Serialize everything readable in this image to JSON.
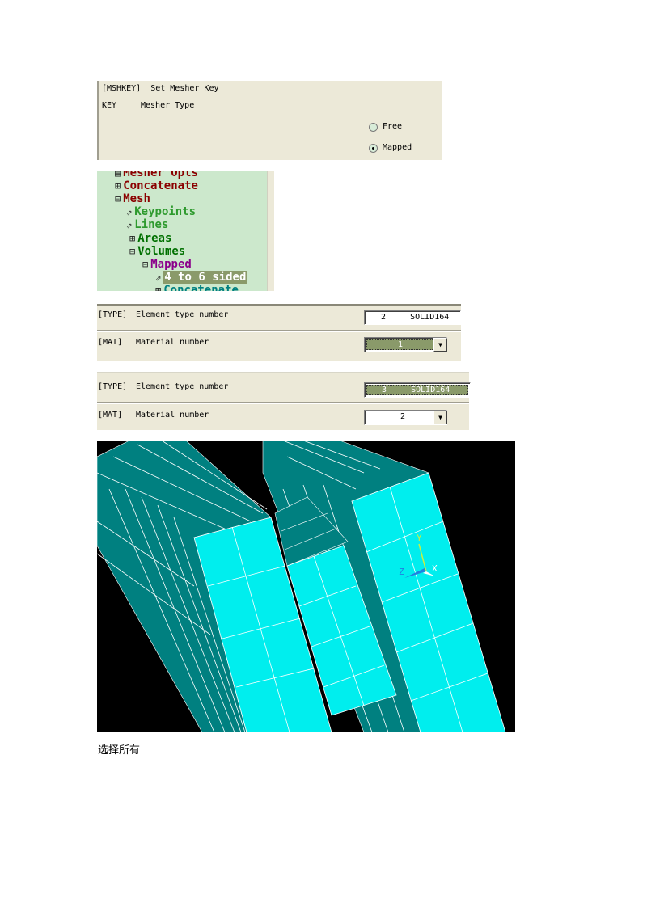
{
  "mshkey_dialog": {
    "title": "[MSHKEY]  Set Mesher Key",
    "key_label": "KEY",
    "field_label": "Mesher Type",
    "options": [
      {
        "label": "Free",
        "selected": false
      },
      {
        "label": "Mapped",
        "selected": true
      }
    ]
  },
  "tree": {
    "items": [
      {
        "label": "Mesher Opts",
        "icon": "dialog-icon",
        "color": "#8b0000"
      },
      {
        "label": "Concatenate",
        "icon": "expand-plus-icon",
        "color": "#8b0000"
      },
      {
        "label": "Mesh",
        "icon": "collapse-minus-icon",
        "color": "#8b0000"
      },
      {
        "label": "Keypoints",
        "icon": "pick-arrow-icon",
        "color": "#2e9a2e"
      },
      {
        "label": "Lines",
        "icon": "pick-arrow-icon",
        "color": "#2e9a2e"
      },
      {
        "label": "Areas",
        "icon": "expand-plus-icon",
        "color": "#007000"
      },
      {
        "label": "Volumes",
        "icon": "collapse-minus-icon",
        "color": "#007000"
      },
      {
        "label": "Mapped",
        "icon": "collapse-minus-icon",
        "color": "#8b008b"
      },
      {
        "label": "4 to 6 sided",
        "icon": "pick-arrow-icon",
        "color": "#ffffff",
        "selected": true
      },
      {
        "label": "Concatenate",
        "icon": "expand-plus-icon",
        "color": "#008080"
      }
    ]
  },
  "attr_dialog_1": {
    "type_label": "[TYPE]",
    "type_desc": "Element type number",
    "type_value": "2     SOLID164",
    "mat_label": "[MAT]",
    "mat_desc": "Material number",
    "mat_value": "1"
  },
  "attr_dialog_2": {
    "type_label": "[TYPE]",
    "type_desc": "Element type number",
    "type_value": "3     SOLID164",
    "mat_label": "[MAT]",
    "mat_desc": "Material number",
    "mat_value": "2"
  },
  "model_view": {
    "axes": {
      "x": "X",
      "y": "Y",
      "z": "Z"
    },
    "colors": {
      "background": "#000000",
      "front_face": "#00eeee",
      "side_face": "#008080",
      "grid": "#ffffff"
    }
  },
  "caption": "选择所有"
}
